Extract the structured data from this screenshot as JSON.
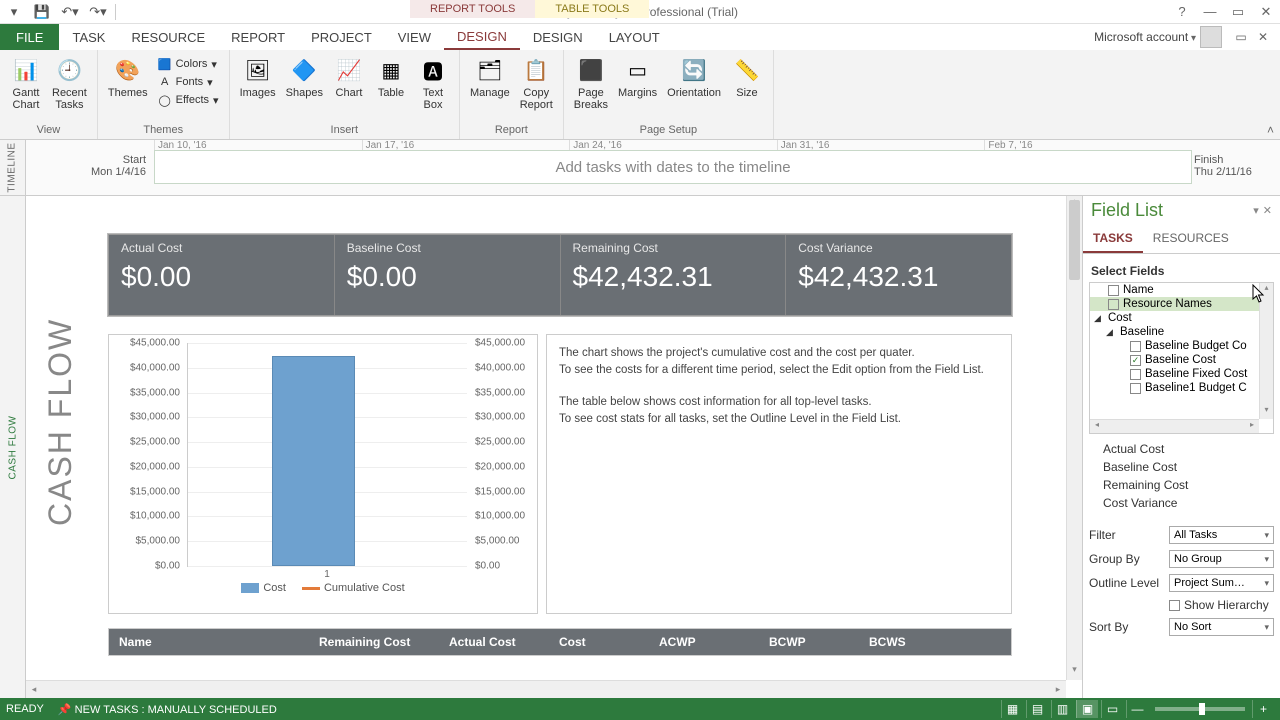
{
  "app": {
    "title": "Project - Project Professional (Trial)",
    "context_tabs": {
      "report": "REPORT TOOLS",
      "table": "TABLE TOOLS"
    }
  },
  "tabs": {
    "file": "FILE",
    "task": "TASK",
    "resource": "RESOURCE",
    "report": "REPORT",
    "project": "PROJECT",
    "view": "VIEW",
    "design1": "DESIGN",
    "design2": "DESIGN",
    "layout": "LAYOUT"
  },
  "account": {
    "label": "Microsoft account"
  },
  "ribbon": {
    "view": {
      "label": "View",
      "gantt": "Gantt\nChart",
      "recent": "Recent\nTasks"
    },
    "themes": {
      "label": "Themes",
      "themes": "Themes",
      "colors": "Colors",
      "fonts": "Fonts",
      "effects": "Effects"
    },
    "insert": {
      "label": "Insert",
      "images": "Images",
      "shapes": "Shapes",
      "chart": "Chart",
      "table": "Table",
      "textbox": "Text\nBox"
    },
    "report": {
      "label": "Report",
      "manage": "Manage",
      "copy": "Copy\nReport"
    },
    "pagesetup": {
      "label": "Page Setup",
      "pagebreaks": "Page\nBreaks",
      "margins": "Margins",
      "orientation": "Orientation",
      "size": "Size"
    }
  },
  "timeline": {
    "side": "TIMELINE",
    "start_label": "Start",
    "start_date": "Mon 1/4/16",
    "end_label": "Finish",
    "end_date": "Thu 2/11/16",
    "placeholder": "Add tasks with dates to the timeline",
    "dates": [
      "Jan 10, '16",
      "Jan 17, '16",
      "Jan 24, '16",
      "Jan 31, '16",
      "Feb 7, '16"
    ]
  },
  "report_body": {
    "side": "CASH FLOW",
    "title": "CASH FLOW",
    "kpis": [
      {
        "label": "Actual Cost",
        "value": "$0.00"
      },
      {
        "label": "Baseline Cost",
        "value": "$0.00"
      },
      {
        "label": "Remaining Cost",
        "value": "$42,432.31"
      },
      {
        "label": "Cost Variance",
        "value": "$42,432.31"
      }
    ],
    "desc": {
      "p1": "The chart shows the project's cumulative cost and the cost per quater.",
      "p2": "To see the costs for a different time period, select the Edit option from the Field List.",
      "p3": "The table below shows cost information for all top-level tasks.",
      "p4": "To see cost stats for all tasks, set the Outline Level in the Field List."
    },
    "table_head": [
      "Name",
      "Remaining Cost",
      "Actual Cost",
      "Cost",
      "ACWP",
      "BCWP",
      "BCWS"
    ]
  },
  "chart_data": {
    "type": "bar",
    "categories": [
      "1"
    ],
    "series": [
      {
        "name": "Cost",
        "values": [
          42432.31
        ]
      },
      {
        "name": "Cumulative Cost",
        "values": [
          42432.31
        ]
      }
    ],
    "ylabel_left_ticks": [
      "$45,000.00",
      "$40,000.00",
      "$35,000.00",
      "$30,000.00",
      "$25,000.00",
      "$20,000.00",
      "$15,000.00",
      "$10,000.00",
      "$5,000.00",
      "$0.00"
    ],
    "ylabel_right_ticks": [
      "$45,000.00",
      "$40,000.00",
      "$35,000.00",
      "$30,000.00",
      "$25,000.00",
      "$20,000.00",
      "$15,000.00",
      "$10,000.00",
      "$5,000.00",
      "$0.00"
    ],
    "ylim": [
      0,
      45000
    ],
    "legend": {
      "cost": "Cost",
      "cum": "Cumulative Cost"
    },
    "x_category": "1"
  },
  "pane": {
    "title": "Field List",
    "tabs": {
      "tasks": "TASKS",
      "resources": "RESOURCES"
    },
    "select_fields": "Select Fields",
    "tree": {
      "name": "Name",
      "resource_names": "Resource Names",
      "cost": "Cost",
      "baseline": "Baseline",
      "baseline_budget_cost": "Baseline Budget Co",
      "baseline_cost": "Baseline Cost",
      "baseline_fixed_cost": "Baseline Fixed Cost",
      "baseline1_budget": "Baseline1 Budget C"
    },
    "selected": [
      "Actual Cost",
      "Baseline Cost",
      "Remaining Cost",
      "Cost Variance"
    ],
    "filter_label": "Filter",
    "filter_value": "All Tasks",
    "groupby_label": "Group By",
    "groupby_value": "No Group",
    "outline_label": "Outline Level",
    "outline_value": "Project Sum…",
    "showhier": "Show Hierarchy",
    "sortby_label": "Sort By",
    "sortby_value": "No Sort"
  },
  "status": {
    "ready": "READY",
    "sched": "NEW TASKS : MANUALLY SCHEDULED"
  }
}
